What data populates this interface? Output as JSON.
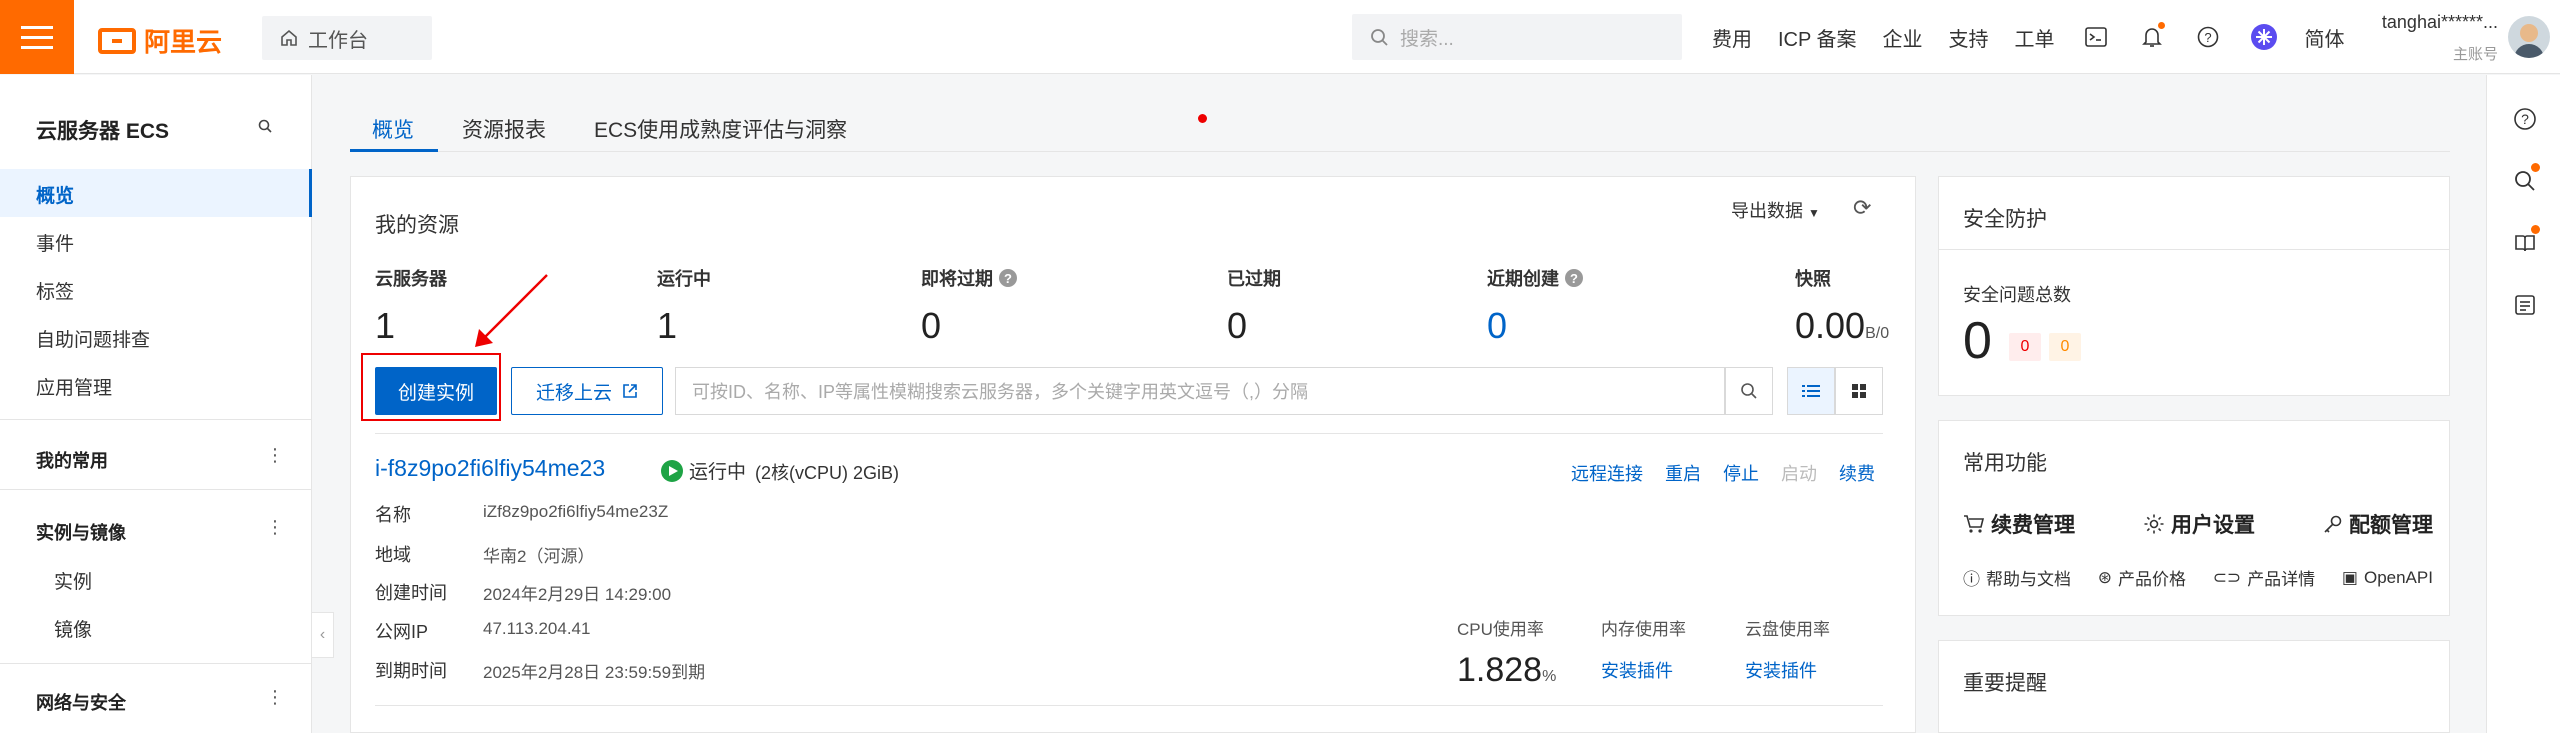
{
  "topbar": {
    "logo_text": "阿里云",
    "workbench": "工作台",
    "search_placeholder": "搜索...",
    "nav": [
      "费用",
      "ICP 备案",
      "企业",
      "支持",
      "工单"
    ],
    "lang": "简体",
    "username": "tanghai******...",
    "account_type": "主账号"
  },
  "sidebar": {
    "title": "云服务器 ECS",
    "items": [
      "概览",
      "事件",
      "标签",
      "自助问题排查",
      "应用管理"
    ],
    "groups": {
      "favorites": "我的常用",
      "instances": "实例与镜像",
      "network": "网络与安全"
    },
    "sub_items": [
      "实例",
      "镜像"
    ]
  },
  "tabs": [
    "概览",
    "资源报表",
    "ECS使用成熟度评估与洞察"
  ],
  "resources": {
    "title": "我的资源",
    "export": "导出数据",
    "stats": [
      {
        "label": "云服务器",
        "value": "1"
      },
      {
        "label": "运行中",
        "value": "1"
      },
      {
        "label": "即将过期",
        "value": "0"
      },
      {
        "label": "已过期",
        "value": "0"
      },
      {
        "label": "近期创建",
        "value": "0"
      },
      {
        "label": "快照",
        "value": "0.00",
        "unit": "B/0"
      }
    ],
    "create_btn": "创建实例",
    "migrate_btn": "迁移上云",
    "filter_placeholder": "可按ID、名称、IP等属性模糊搜索云服务器，多个关键字用英文逗号（,）分隔"
  },
  "instance": {
    "id": "i-f8z9po2fi6lfiy54me23",
    "status": "运行中",
    "spec": "(2核(vCPU) 2GiB)",
    "actions": [
      "远程连接",
      "重启",
      "停止",
      "启动",
      "续费"
    ],
    "fields": [
      {
        "key": "名称",
        "value": "iZf8z9po2fi6lfiy54me23Z"
      },
      {
        "key": "地域",
        "value": "华南2（河源）"
      },
      {
        "key": "创建时间",
        "value": "2024年2月29日 14:29:00"
      },
      {
        "key": "公网IP",
        "value": "47.113.204.41"
      },
      {
        "key": "到期时间",
        "value": "2025年2月28日 23:59:59到期"
      }
    ],
    "metrics": {
      "cpu_label": "CPU使用率",
      "cpu_value": "1.828",
      "cpu_unit": "%",
      "mem_label": "内存使用率",
      "mem_link": "安装插件",
      "disk_label": "云盘使用率",
      "disk_link": "安装插件"
    }
  },
  "security": {
    "title": "安全防护",
    "total_label": "安全问题总数",
    "total": "0",
    "high": "0",
    "medium": "0"
  },
  "functions": {
    "title": "常用功能",
    "main": [
      "续费管理",
      "用户设置",
      "配额管理"
    ],
    "links": [
      "帮助与文档",
      "产品价格",
      "产品详情",
      "OpenAPI"
    ]
  },
  "notice": {
    "title": "重要提醒"
  },
  "colors": {
    "brand": "#ff6a00",
    "primary": "#0064c8",
    "success": "#1ea345",
    "alert": "#e00000"
  }
}
